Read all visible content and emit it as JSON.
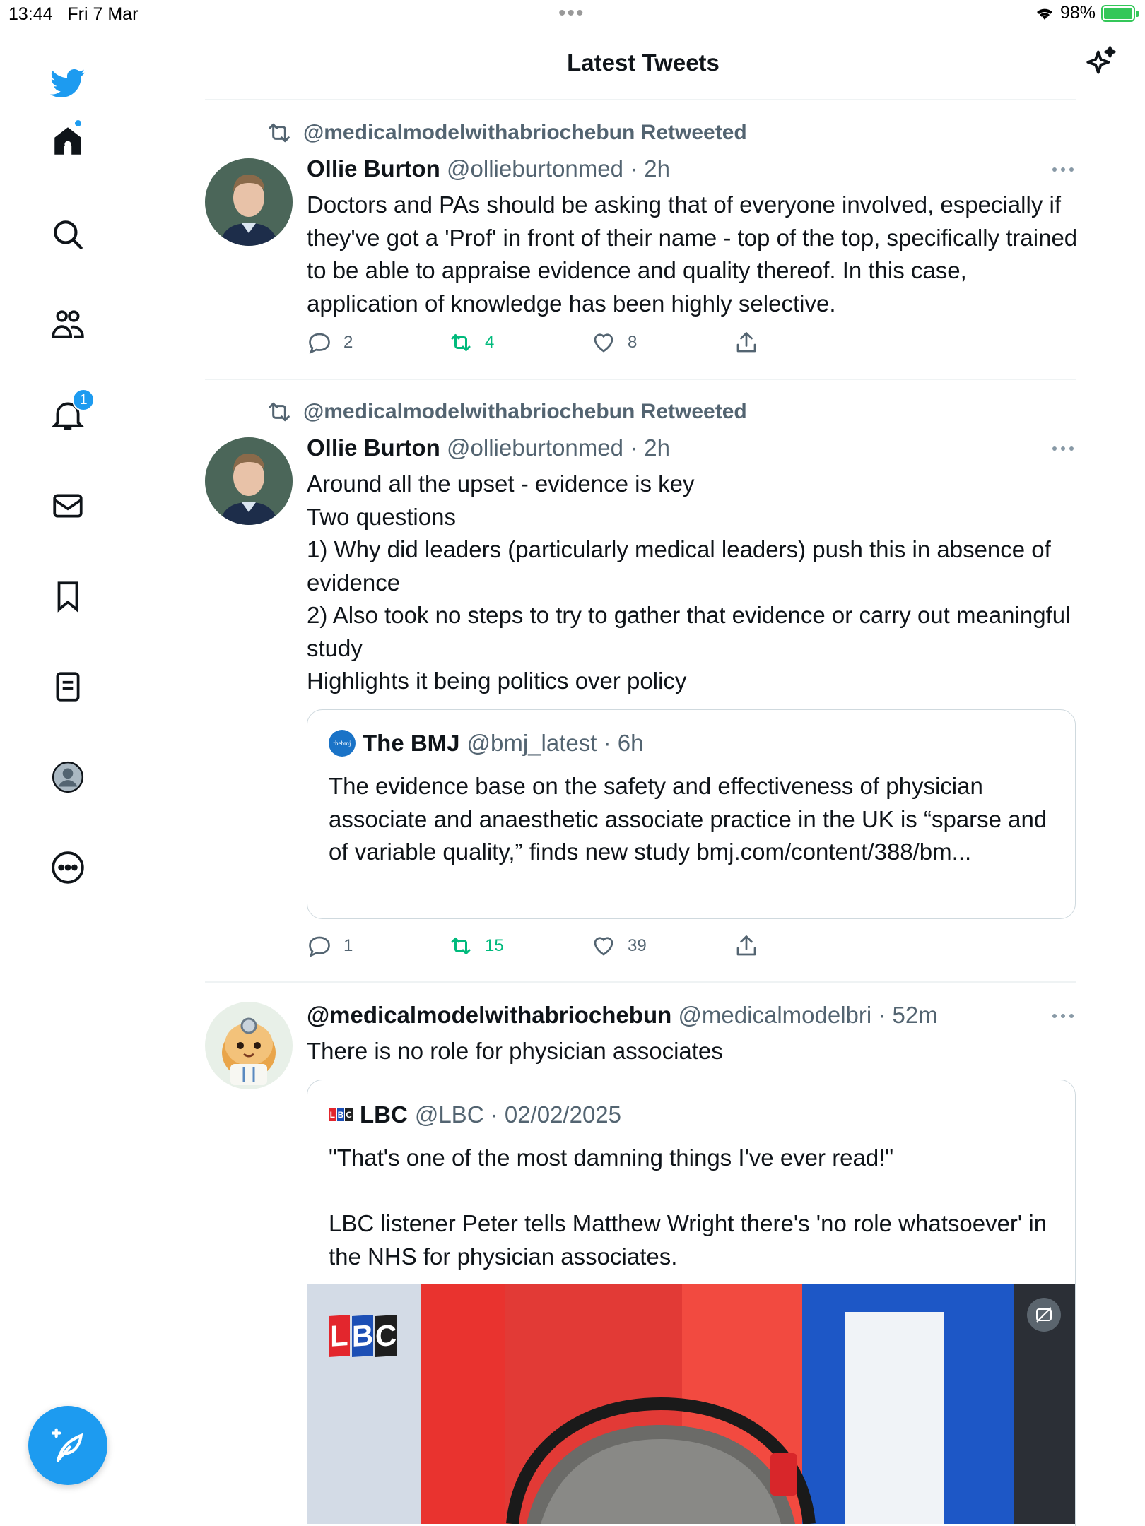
{
  "status_bar": {
    "time": "13:44",
    "date": "Fri 7 Mar",
    "battery": "98%"
  },
  "header": {
    "title": "Latest Tweets"
  },
  "sidebar": {
    "items": [
      "home",
      "search",
      "communities",
      "notifications",
      "messages",
      "bookmarks",
      "lists",
      "profile",
      "more"
    ],
    "notification_count": "1"
  },
  "tweets": [
    {
      "retweeted_by": "@medicalmodelwithabriochebun Retweeted",
      "name": "Ollie Burton",
      "meta": "@ollieburtonmed · 2h",
      "text": "Doctors and PAs should be asking that of everyone involved, especially if they've got a 'Prof' in front of their name - top of the top, specifically trained to be able to appraise evidence and quality thereof. In this case, application of knowledge has been highly selective.",
      "replies": "2",
      "retweets": "4",
      "likes": "8"
    },
    {
      "retweeted_by": "@medicalmodelwithabriochebun Retweeted",
      "name": "Ollie Burton",
      "meta": "@ollieburtonmed · 2h",
      "text": "Around all the upset - evidence is key\nTwo questions\n1) Why did leaders (particularly medical leaders) push this in absence of evidence\n2) Also took no steps to try to gather that evidence or carry out meaningful study\nHighlights it being politics over policy",
      "quote": {
        "logo_text": "thebmj",
        "name": "The BMJ",
        "meta": "@bmj_latest · 6h",
        "text": "The evidence base on the safety and effectiveness of physician associate and anaesthetic associate practice in the UK is “sparse and of variable quality,” finds new study bmj.com/content/388/bm..."
      },
      "replies": "1",
      "retweets": "15",
      "likes": "39"
    },
    {
      "name": "@medicalmodelwithabriochebun",
      "meta": "@medicalmodelbri · 52m",
      "text": "There is no role for physician associates",
      "quote": {
        "logo_text": [
          "L",
          "B",
          "C"
        ],
        "name": "LBC",
        "meta": "@LBC · 02/02/2025",
        "text": "\"That's one of the most damning things I've ever read!\"\n\nLBC listener Peter tells Matthew Wright there's 'no role whatsoever' in the NHS for physician associates.",
        "media_logo": [
          "L",
          "B",
          "C"
        ]
      }
    }
  ],
  "colors": {
    "accent": "#1d9bf0",
    "retweet_green": "#00ba7c",
    "secondary_text": "#536471",
    "border": "#eff3f4"
  }
}
